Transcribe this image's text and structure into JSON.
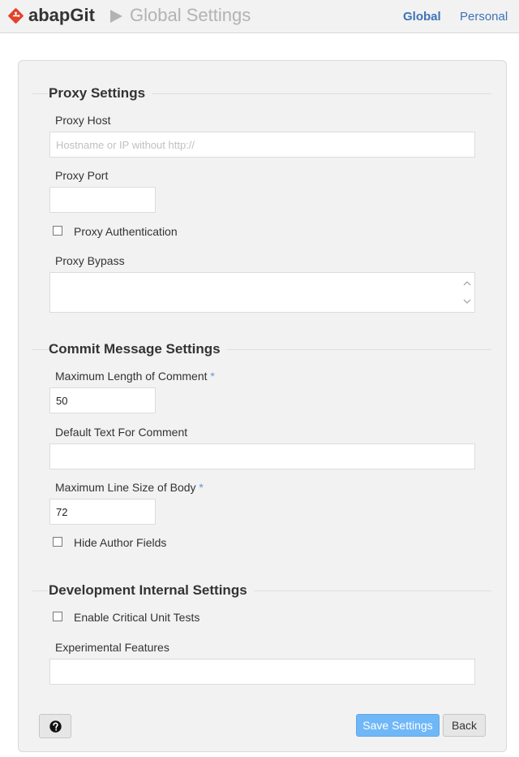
{
  "header": {
    "logo_text": "abapGit",
    "page_title": "Global Settings",
    "nav": {
      "global": "Global",
      "personal": "Personal"
    },
    "active_nav": "Global",
    "brand_color": "#e24329",
    "link_color": "#3e73b8"
  },
  "proxy": {
    "title": "Proxy Settings",
    "host_label": "Proxy Host",
    "host_placeholder": "Hostname or IP without http://",
    "host_value": "",
    "port_label": "Proxy Port",
    "port_value": "",
    "auth_label": "Proxy Authentication",
    "auth_checked": false,
    "bypass_label": "Proxy Bypass",
    "bypass_value": ""
  },
  "commit": {
    "title": "Commit Message Settings",
    "max_comment_label": "Maximum Length of Comment",
    "max_comment_value": "50",
    "default_text_label": "Default Text For Comment",
    "default_text_value": "",
    "max_line_label": "Maximum Line Size of Body",
    "max_line_value": "72",
    "hide_author_label": "Hide Author Fields",
    "hide_author_checked": false,
    "required_marker": "*"
  },
  "dev": {
    "title": "Development Internal Settings",
    "critical_tests_label": "Enable Critical Unit Tests",
    "critical_tests_checked": false,
    "experimental_label": "Experimental Features",
    "experimental_value": ""
  },
  "actions": {
    "save_label": "Save Settings",
    "back_label": "Back",
    "help_icon": "question-circle-icon",
    "save_color": "#6fb7f7"
  }
}
